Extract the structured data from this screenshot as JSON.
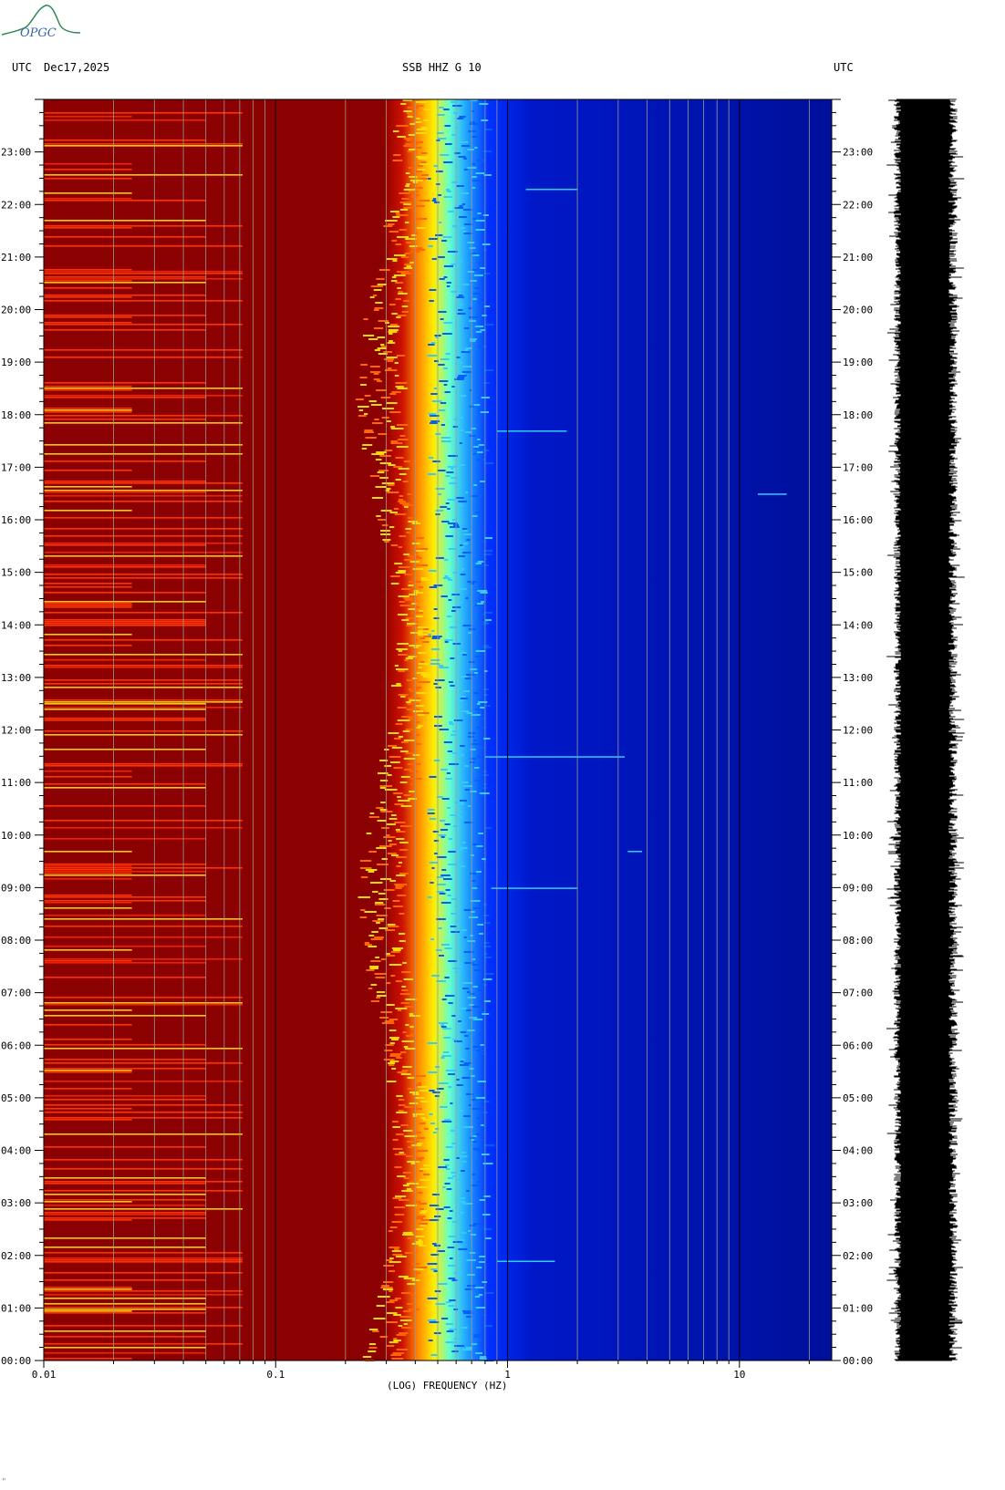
{
  "header": {
    "utc_left": "UTC",
    "date": "Dec17,2025",
    "station": "SSB HHZ G 10",
    "utc_right": "UTC",
    "logo_text": "OPGC"
  },
  "chart_data": {
    "type": "heatmap",
    "title": "SSB HHZ G 10",
    "xlabel": "(LOG) FREQUENCY (HZ)",
    "xscale": "log",
    "xlim": [
      0.01,
      25
    ],
    "x_ticks": [
      "0.01",
      "0.1",
      "1",
      "10"
    ],
    "x_tick_values": [
      0.01,
      0.1,
      1,
      10
    ],
    "ylabel": "UTC",
    "ylim_hours": [
      0,
      24
    ],
    "y_ticks": [
      "00:00",
      "01:00",
      "02:00",
      "03:00",
      "04:00",
      "05:00",
      "06:00",
      "07:00",
      "08:00",
      "09:00",
      "10:00",
      "11:00",
      "12:00",
      "13:00",
      "14:00",
      "15:00",
      "16:00",
      "17:00",
      "18:00",
      "19:00",
      "20:00",
      "21:00",
      "22:00",
      "23:00"
    ],
    "colormap": [
      "#00008b",
      "#0000ff",
      "#00ffff",
      "#ffff00",
      "#ff0000",
      "#8b0000"
    ],
    "description_bands": [
      {
        "from_hz": 0.01,
        "to_hz": 0.3,
        "level": "high"
      },
      {
        "from_hz": 0.3,
        "to_hz": 0.8,
        "level": "transition"
      },
      {
        "from_hz": 0.8,
        "to_hz": 25,
        "level": "low"
      }
    ]
  },
  "colors": {
    "dark_red": "#8b0000",
    "red": "#cc0000",
    "yellow": "#ffdd00",
    "cyan": "#33ccff",
    "blue": "#0018c8",
    "navy": "#00109a",
    "grid": "#9a9a9a"
  },
  "footer": {
    "mark": "\""
  }
}
